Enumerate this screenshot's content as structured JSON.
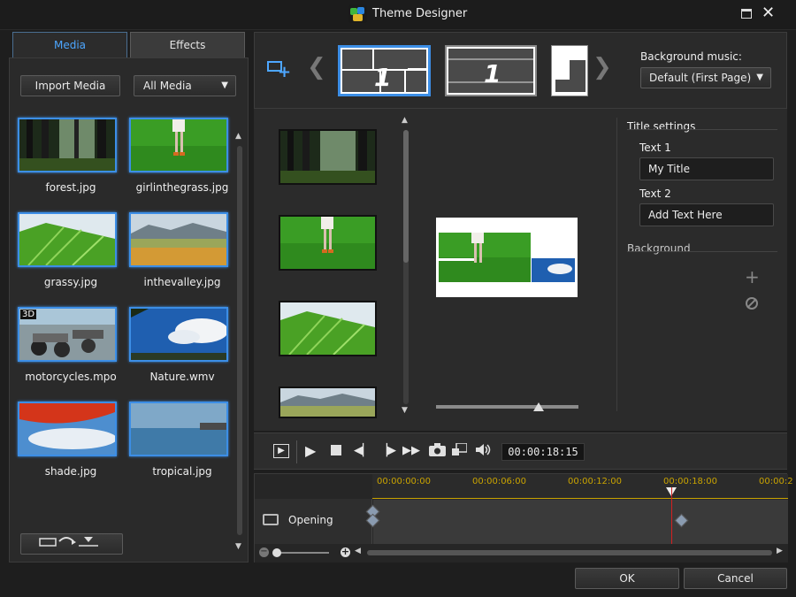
{
  "window": {
    "title": "Theme Designer"
  },
  "tabs": [
    {
      "label": "Media"
    },
    {
      "label": "Effects"
    }
  ],
  "media_panel": {
    "import_label": "Import Media",
    "filter_value": "All Media",
    "items": [
      {
        "label": "forest.jpg",
        "is_3d": false
      },
      {
        "label": "girlinthegrass.jpg",
        "is_3d": false
      },
      {
        "label": "grassy.jpg",
        "is_3d": false
      },
      {
        "label": "inthevalley.jpg",
        "is_3d": false
      },
      {
        "label": "motorcycles.mpo",
        "is_3d": true,
        "badge": "3D"
      },
      {
        "label": "Nature.wmv",
        "is_3d": false
      },
      {
        "label": "shade.jpg",
        "is_3d": false
      },
      {
        "label": "tropical.jpg",
        "is_3d": false
      }
    ]
  },
  "templates": {
    "items": [
      {
        "number": "1"
      },
      {
        "number": "1"
      },
      {
        "number": ""
      }
    ],
    "selected_index": 0
  },
  "background_music": {
    "label": "Background music:",
    "value": "Default (First Page)"
  },
  "title_settings": {
    "heading": "Title settings",
    "text1_label": "Text 1",
    "text1_value": "My Title",
    "text2_label": "Text 2",
    "text2_value": "Add Text Here",
    "background_heading": "Background"
  },
  "playback": {
    "timecode": "00:00:18:15"
  },
  "timeline": {
    "ticks": [
      "00:00:00:00",
      "00:00:06:00",
      "00:00:12:00",
      "00:00:18:00",
      "00:00:2"
    ],
    "track_name": "Opening"
  },
  "colors": {
    "accent": "#3c8ee6",
    "ruler": "#c9a300",
    "playhead": "#d42020"
  },
  "buttons": {
    "ok": "OK",
    "cancel": "Cancel"
  }
}
